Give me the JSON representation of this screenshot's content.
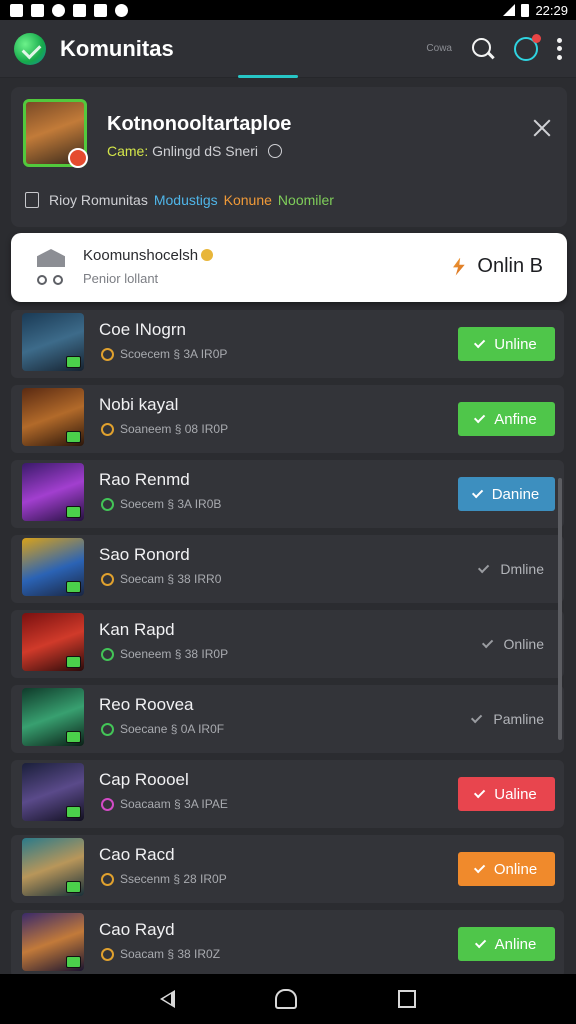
{
  "status_bar": {
    "time": "22:29"
  },
  "app_bar": {
    "title": "Komunitas",
    "small_label": "Cowa"
  },
  "community": {
    "title": "Kotnonooltartaploe",
    "game_label": "Came:",
    "game_value": "Gnlingd dS Sneri",
    "meta_prefix": "Rioy Romunitas",
    "meta_blue": "Modustigs",
    "meta_orange": "Konune",
    "meta_green": "Noomiler"
  },
  "feature": {
    "title": "Koomunshocelsh",
    "subtitle": "Penior lollant",
    "status": "Onlin B"
  },
  "colors": {
    "green": "#4fc64a",
    "blue": "#3d8fbf",
    "red": "#e8454e",
    "orange": "#f08a2c",
    "tab_indicator": "#27c6c6"
  },
  "members": [
    {
      "name": "Coe INogrn",
      "meta": "Scoecem § 3A IR0P",
      "badge": "orange",
      "status": "Unline",
      "style": "green"
    },
    {
      "name": "Nobi kayal",
      "meta": "Soaneem § 08 IR0P",
      "badge": "orange",
      "status": "Anfine",
      "style": "green"
    },
    {
      "name": "Rao Renmd",
      "meta": "Soecem § 3A IR0B",
      "badge": "green",
      "status": "Danine",
      "style": "blue"
    },
    {
      "name": "Sao Ronord",
      "meta": "Soecam § 38 IRR0",
      "badge": "orange",
      "status": "Dmline",
      "style": "plain"
    },
    {
      "name": "Kan Rapd",
      "meta": "Soeneem § 38 IR0P",
      "badge": "green",
      "status": "Online",
      "style": "plain"
    },
    {
      "name": "Reo Roovea",
      "meta": "Soecane § 0A IR0F",
      "badge": "green",
      "status": "Pamline",
      "style": "plain"
    },
    {
      "name": "Cap Roooel",
      "meta": "Soacaam § 3A IPAE",
      "badge": "pink",
      "status": "Ualine",
      "style": "red"
    },
    {
      "name": "Cao Racd",
      "meta": "Ssecenm § 28 IR0P",
      "badge": "orange",
      "status": "Online",
      "style": "orange"
    },
    {
      "name": "Cao Rayd",
      "meta": "Soacam § 38 IR0Z",
      "badge": "orange",
      "status": "Anline",
      "style": "green"
    }
  ]
}
